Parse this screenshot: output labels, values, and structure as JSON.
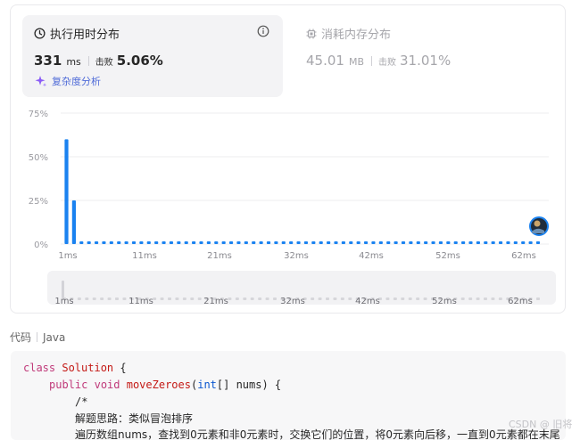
{
  "runtime_tab": {
    "title": "执行用时分布",
    "value": "331",
    "unit": "ms",
    "beats_label": "击败",
    "beats_value": "5.06%",
    "analysis_link": "复杂度分析"
  },
  "memory_tab": {
    "title": "消耗内存分布",
    "value": "45.01",
    "unit": "MB",
    "beats_label": "击败",
    "beats_value": "31.01%"
  },
  "colors": {
    "bar": "#1a82f0",
    "accent_purple": "#8b5cf6",
    "link": "#4f6bd8"
  },
  "chart_data": {
    "type": "bar",
    "y_ticks": [
      "75%",
      "50%",
      "25%",
      "0%"
    ],
    "ylim": [
      0,
      75
    ],
    "x_ticks": [
      "1ms",
      "11ms",
      "21ms",
      "32ms",
      "42ms",
      "52ms",
      "62ms"
    ],
    "values": [
      60,
      25,
      1.5,
      1.5,
      1.5,
      1.5,
      1.5,
      1.5,
      1.5,
      1.5,
      1.5,
      1.5,
      1.5,
      1.5,
      1.5,
      1.5,
      1.5,
      1.5,
      1.5,
      1.5,
      1.5,
      1.5,
      1.5,
      1.5,
      1.5,
      1.5,
      1.5,
      1.5,
      1.5,
      1.5,
      1.5,
      1.5,
      1.5,
      1.5,
      1.5,
      1.5,
      1.5,
      1.5,
      1.5,
      1.5,
      1.5,
      1.5,
      1.5,
      1.5,
      1.5,
      1.5,
      1.5,
      1.5,
      1.5,
      1.5,
      1.5,
      1.5,
      1.5,
      1.5,
      1.5,
      1.5,
      1.5,
      1.5,
      1.5,
      1.5,
      1.5,
      1.5,
      1.5,
      1.5
    ],
    "grid": true,
    "user_marker": "avatar"
  },
  "navigator": {
    "x_ticks": [
      "1ms",
      "11ms",
      "21ms",
      "32ms",
      "42ms",
      "52ms",
      "62ms"
    ]
  },
  "code": {
    "label": "代码",
    "language": "Java",
    "lines": {
      "l1_kw": "class",
      "l1_cls": "Solution",
      "l1_rest": " {",
      "l2_mod": "public",
      "l2_void": "void",
      "l2_fn": "moveZeroes",
      "l2_rest1": "(",
      "l2_type": "int",
      "l2_rest2": "[] nums) {",
      "l3": "/*",
      "l4": "解题思路：类似冒泡排序",
      "l5": "遍历数组nums，查找到0元素和非0元素时，交换它们的位置，将0元素向后移，一直到0元素都在末尾"
    }
  },
  "watermark": "CSDN @ 旧将"
}
